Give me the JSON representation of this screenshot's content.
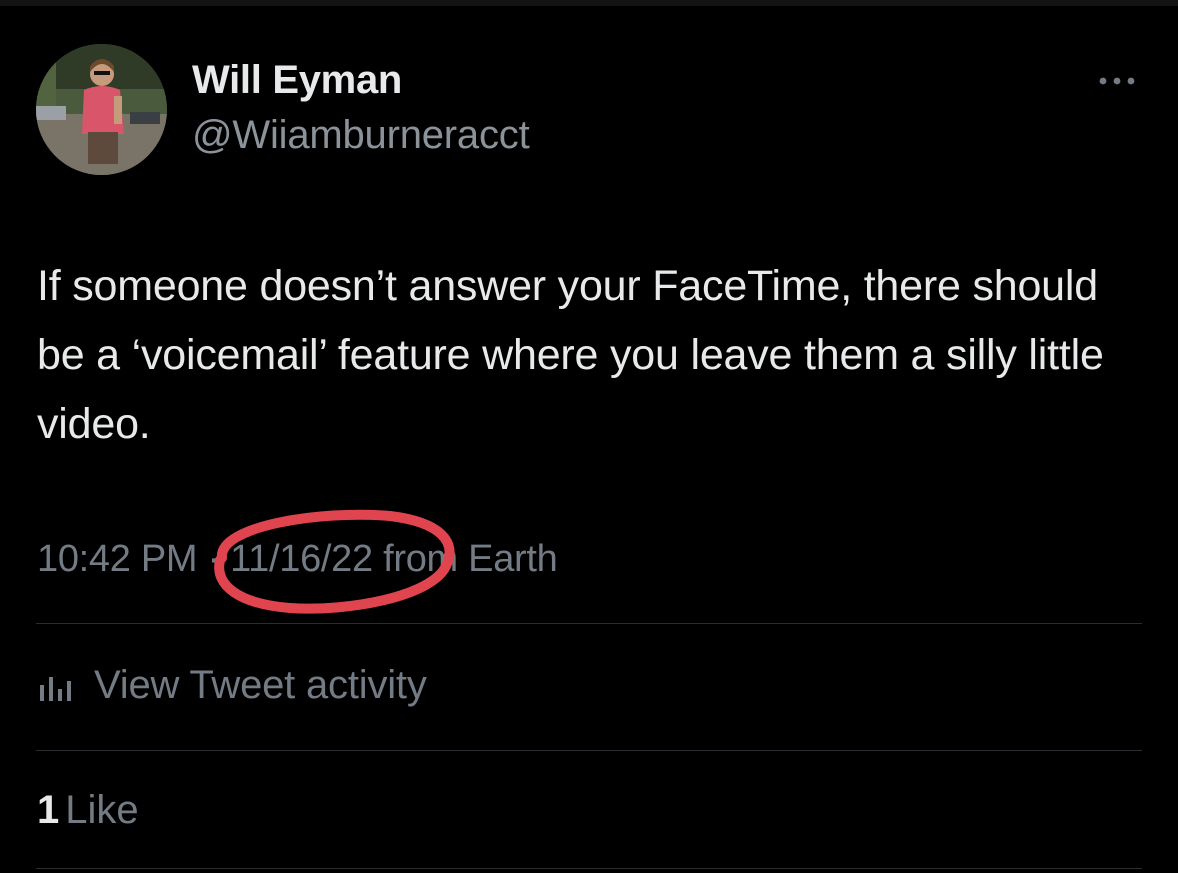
{
  "tweet": {
    "author": {
      "display_name": "Will Eyman",
      "handle": "@Wiiamburneracct"
    },
    "text": "If someone doesn’t answer your FaceTime, there should be a ‘voicemail’ feature where you leave them a silly little video.",
    "meta": {
      "time": "10:42 PM",
      "separator": " · ",
      "date": "11/16/22",
      "source": " from Earth"
    },
    "activity_label": "View Tweet activity",
    "likes": {
      "count": "1",
      "label": "Like"
    }
  },
  "icons": {
    "more": "more-horizontal-icon",
    "activity": "bar-chart-icon"
  },
  "colors": {
    "background": "#000000",
    "primary_text": "#e7e9ea",
    "secondary_text": "#737b84",
    "divider": "#2a2e33",
    "highlight_circle": "#e0454f"
  }
}
